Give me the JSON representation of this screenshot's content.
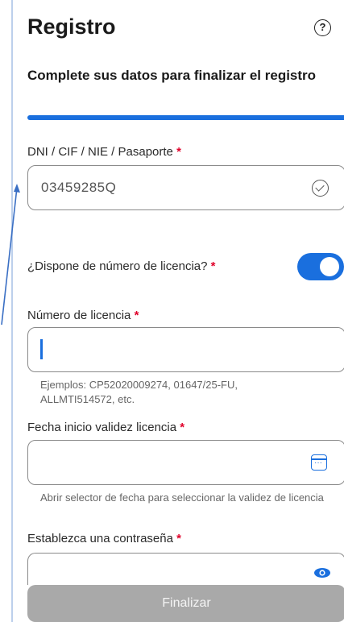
{
  "header": {
    "title": "Registro",
    "help_icon": "?"
  },
  "form": {
    "subtitle": "Complete sus datos para finalizar el registro",
    "id_document": {
      "label": "DNI / CIF / NIE / Pasaporte",
      "value": "03459285Q"
    },
    "has_license": {
      "label": "¿Dispone de número de licencia?",
      "on": true
    },
    "license_number": {
      "label": "Número de licencia",
      "value": "",
      "hint": "Ejemplos: CP52020009274, 01647/25-FU, ALLMTI514572, etc."
    },
    "license_start_date": {
      "label": "Fecha inicio validez licencia",
      "value": "",
      "hint": "Abrir selector de fecha para seleccionar la validez de licencia"
    },
    "password": {
      "label": "Establezca una contraseña",
      "value": ""
    },
    "required_mark": "*",
    "submit_label": "Finalizar"
  },
  "colors": {
    "accent": "#1a6fde",
    "required": "#e0002a",
    "disabled_button": "#a9a9a9"
  },
  "icons": [
    "help-icon",
    "check-circle-icon",
    "calendar-icon",
    "eye-icon",
    "arrow-icon"
  ]
}
